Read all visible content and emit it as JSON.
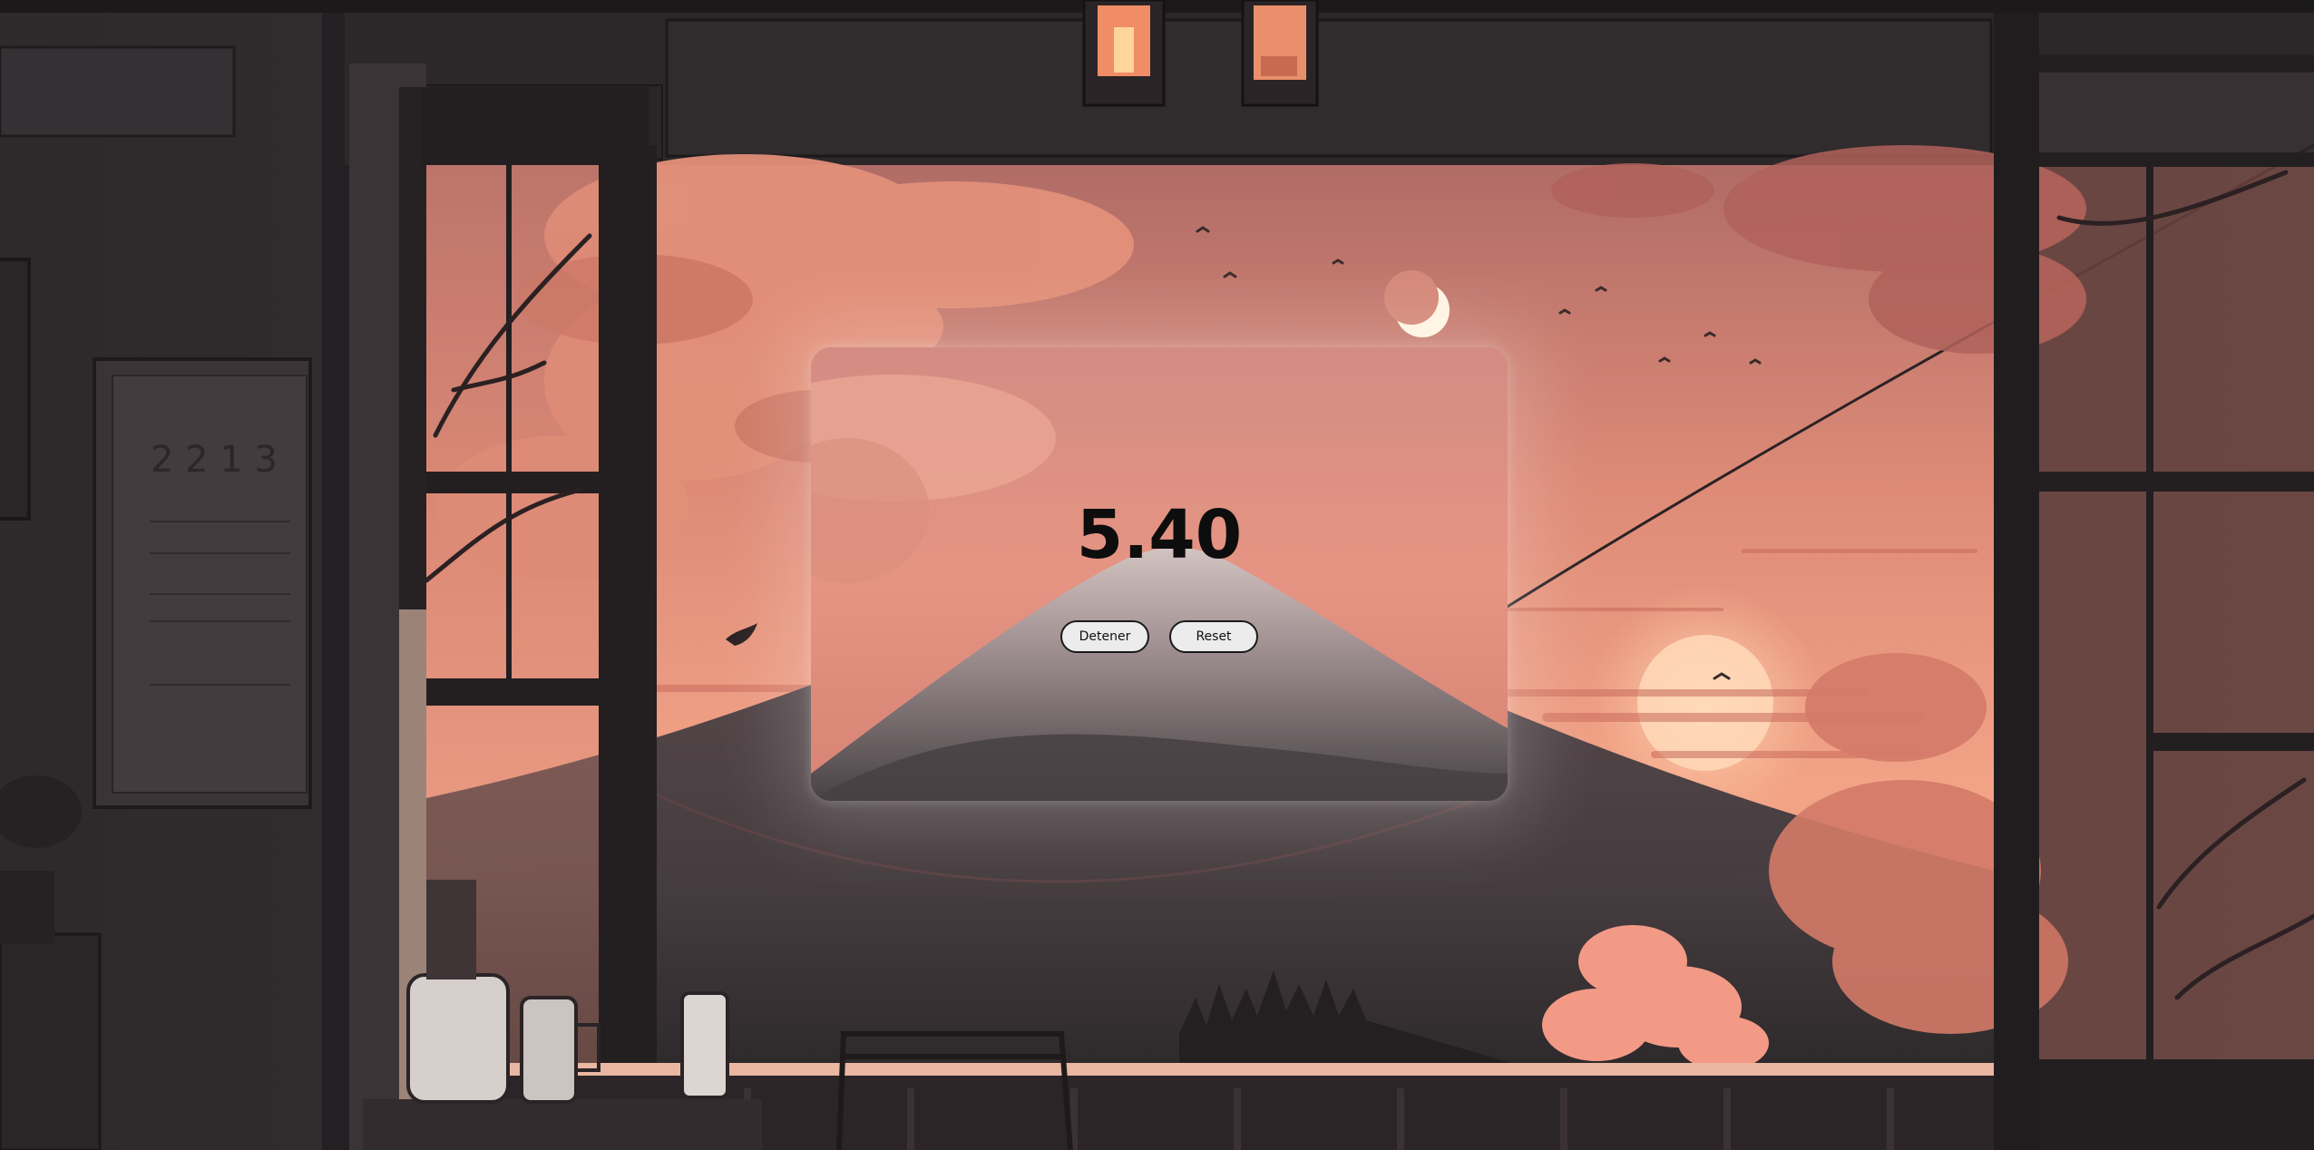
{
  "timer": {
    "value": "5.40"
  },
  "controls": {
    "stop_label": "Detener",
    "reset_label": "Reset"
  },
  "colors": {
    "sky_top": "#b8716a",
    "sky_mid": "#e48d78",
    "sky_horizon": "#f7b08d",
    "mountain": "#4a4244",
    "snow": "#d8c2c0",
    "foliage": "#e3907c",
    "interior_wall": "#2f2b2d",
    "frame_dark": "#211e20",
    "button_bg": "#ececec",
    "button_border": "#1a1a1a",
    "timer_text": "#0d0d0d"
  },
  "icons": {
    "moon": "crescent-moon-icon",
    "sun": "setting-sun-icon"
  }
}
